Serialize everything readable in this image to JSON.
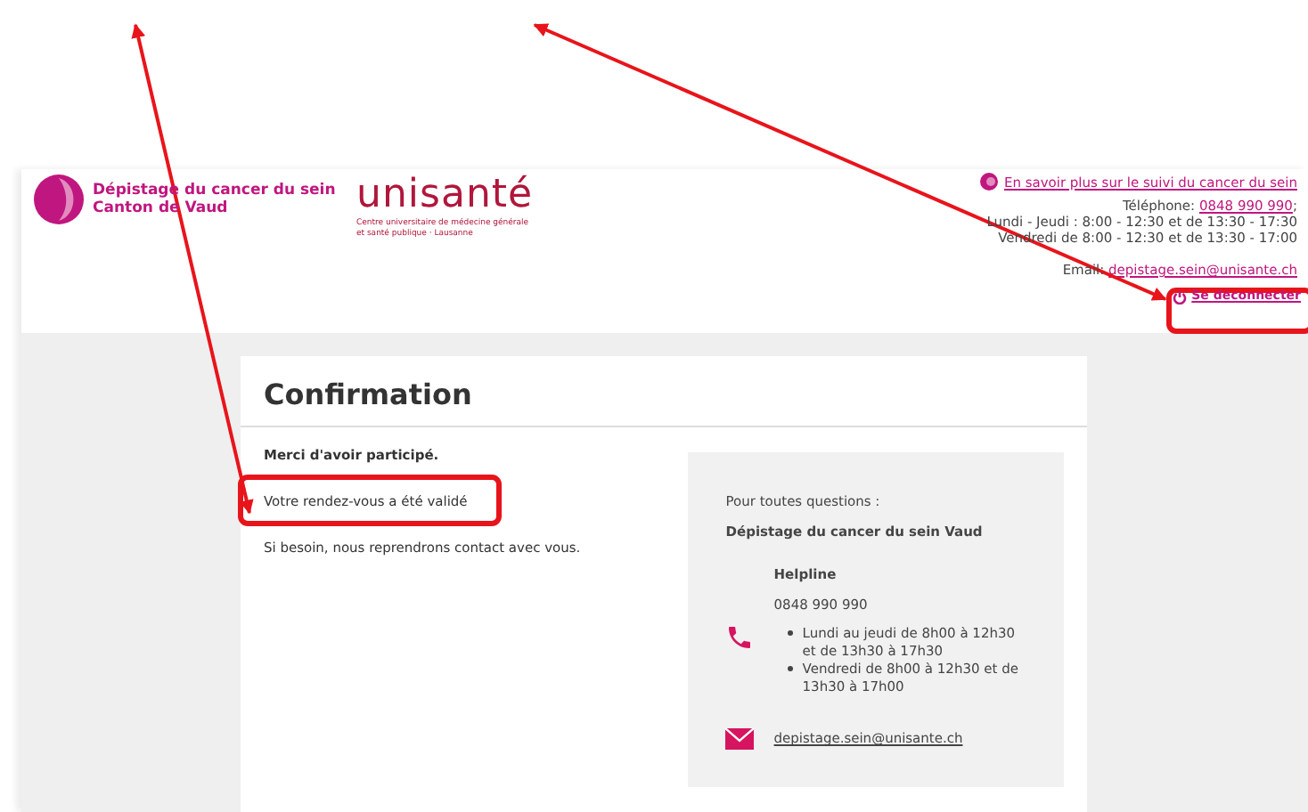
{
  "header": {
    "logo": {
      "line1": "Dépistage du cancer du sein",
      "line2": "Canton de Vaud"
    },
    "partner": {
      "name": "unisanté",
      "subtitle1": "Centre universitaire de médecine générale",
      "subtitle2": "et santé publique · Lausanne"
    },
    "info_link": "En savoir plus sur le suivi du cancer du sein",
    "phone_label": "Téléphone:",
    "phone": "0848 990 990",
    "phone_after": ";",
    "hours": [
      "Lundi - Jeudi : 8:00 - 12:30 et de 13:30 - 17:30",
      "Vendredi de 8:00 - 12:30 et de 13:30 - 17:00"
    ],
    "email_label": "Email:",
    "email": "depistage.sein@unisante.ch",
    "logout": "Se déconnecter"
  },
  "card": {
    "title": "Confirmation",
    "thanks": "Merci d'avoir participé.",
    "status": "Votre rendez-vous a été validé",
    "note": "Si besoin, nous reprendrons contact avec vous.",
    "contact": {
      "intro": "Pour toutes questions :",
      "org": "Dépistage du cancer du sein Vaud",
      "helpline_title": "Helpline",
      "helpline_phone": "0848 990 990",
      "hours": [
        "Lundi au jeudi de 8h00 à 12h30 et de 13h30 à 17h30",
        "Vendredi de 8h00 à 12h30 et de 13h30 à 17h00"
      ],
      "email": "depistage.sein@unisante.ch"
    }
  }
}
